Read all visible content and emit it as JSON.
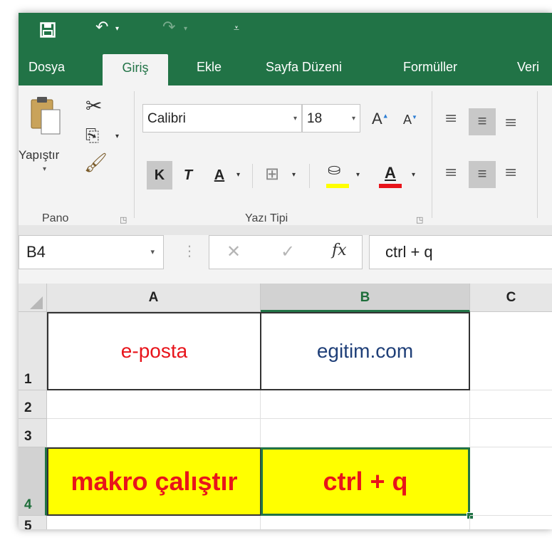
{
  "quick_access": {
    "save_icon": "save-icon",
    "undo_icon": "undo-icon",
    "redo_icon": "redo-icon",
    "customize_icon": "customize-qat-icon"
  },
  "tabs": [
    "Dosya",
    "Giriş",
    "Ekle",
    "Sayfa Düzeni",
    "Formüller",
    "Veri"
  ],
  "active_tab": "Giriş",
  "ribbon": {
    "paste_label": "Yapıştır",
    "clipboard_group": "Pano",
    "font_group": "Yazı Tipi",
    "font_name": "Calibri",
    "font_size": "18",
    "grow_font": "A",
    "shrink_font": "A",
    "bold": "K",
    "italic": "T",
    "underline": "A",
    "font_color_letter": "A"
  },
  "formula_bar": {
    "name_box": "B4",
    "fx": "fx",
    "formula": "ctrl + q"
  },
  "columns": [
    "A",
    "B",
    "C"
  ],
  "rows": [
    "1",
    "2",
    "3",
    "4",
    "5"
  ],
  "cells": {
    "A1": "e-posta",
    "B1": "egitim.com",
    "A4": "makro çalıştır",
    "B4": "ctrl + q"
  },
  "colors": {
    "accent": "#217346",
    "highlight_fill": "#ffff00",
    "red_text": "#e8141b",
    "blue_text": "#1f3f78"
  }
}
